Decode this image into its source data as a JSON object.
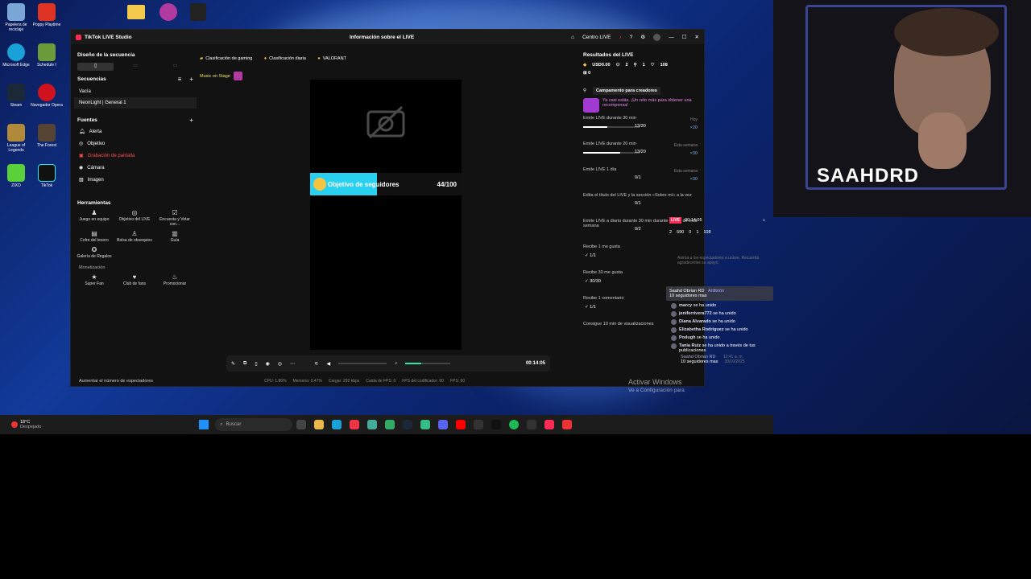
{
  "window": {
    "title": "TikTok LIVE Studio",
    "center_title": "Información sobre el LIVE",
    "centro_live": "Centro LIVE"
  },
  "left": {
    "scene_design": "Diseño de la secuencia",
    "sequences_title": "Secuencias",
    "sequences": [
      "Vacía",
      "NeonLight | General 1"
    ],
    "sources_title": "Fuentes",
    "sources": [
      {
        "label": "Alerta",
        "icon": "bell-icon"
      },
      {
        "label": "Objetivo",
        "icon": "target-icon"
      },
      {
        "label": "Grabación de pantalla",
        "icon": "screen-record-icon",
        "color": "#ff4d4d"
      },
      {
        "label": "Cámara",
        "icon": "camera-icon"
      },
      {
        "label": "Imagen",
        "icon": "image-icon"
      }
    ],
    "tools_title": "Herramientas",
    "tools": [
      "Juego en equipo",
      "Objetivo del LIVE",
      "Encuesta y Votar con...",
      "Cofre del tesoro",
      "Bolsa de obsequios",
      "Guía",
      "Galería de Regalos"
    ],
    "monetization_title": "Monetización",
    "monetization": [
      "Super Fan",
      "Club de fans",
      "Promocionar"
    ],
    "footer": "Aumentar el número de espectadores"
  },
  "center": {
    "chips": [
      "Clasificación de gaming",
      "Clasificación diaria",
      "VALORANT"
    ],
    "music": "Music on Stage",
    "goal_label": "Objetivo de seguidores",
    "goal_count": "44/100",
    "goal_fraction": 0.44,
    "timer": "00:14:05",
    "stats": [
      "CPU: 1.86%",
      "Memoria: 0.47%",
      "Cargar: 292 kbps",
      "Caída de FPS: 0",
      "FPS del codificador: 60",
      "FPS: 60"
    ]
  },
  "right": {
    "title": "Resultados del LIVE",
    "usd": "USD0.00",
    "stat_a": "2",
    "stat_b": "1",
    "likes": "108",
    "gifts": "0",
    "camp": "Campamento para creadores",
    "camp_desc": "Ya casi estás. ¡Un reto más para obtener una recompensa!",
    "tasks": [
      {
        "title": "Emite LIVE durante 30 min",
        "count": "13/30",
        "tag": "Hoy",
        "reward": "×20",
        "progress": 0.43
      },
      {
        "title": "Emite LIVE durante 20 min",
        "count": "13/20",
        "tag": "Esta semana",
        "reward": "×30",
        "progress": 0.65
      },
      {
        "title": "Emite LIVE 1 día",
        "count": "0/1",
        "tag": "Esta semana",
        "reward": "×30",
        "progress": 0
      },
      {
        "title": "Edita el título del LIVE y la sección «Sobre mí» a la vez",
        "count": "0/1",
        "tag": "",
        "reward": "",
        "progress": 0
      },
      {
        "title": "Emite LIVE a diario durante 30 min durante 2 días de esta semana",
        "count": "0/2",
        "tag": "",
        "reward": "",
        "progress": 0
      },
      {
        "title": "Recibe 1 me gusta",
        "count": "1/1",
        "tag": "",
        "reward": "",
        "progress": 1
      },
      {
        "title": "Recibe 30 me gusta",
        "count": "30/30",
        "tag": "",
        "reward": "",
        "progress": 1
      },
      {
        "title": "Recibe 1 comentario",
        "count": "1/1",
        "tag": "",
        "reward": "",
        "progress": 1
      },
      {
        "title": "Consigue 10 min de visualizaciones",
        "count": "",
        "tag": "",
        "reward": "",
        "progress": 0
      }
    ]
  },
  "overlay": {
    "live_badge": "LIVE",
    "time": "00:14:05",
    "stats": [
      "2",
      "590",
      "0",
      "1",
      "108"
    ],
    "hint": "Anima a los espectadores a unirse. Recuerda agradecerles su apoyo.",
    "top_user": "Saahd Obrian RD",
    "top_badge": "Anfitrión",
    "top_msg": "10 seguidores mas",
    "joins": [
      {
        "name": "marcy",
        "msg": "se ha unido"
      },
      {
        "name": "jeniferrivera772",
        "msg": "se ha unido"
      },
      {
        "name": "Diana Alvarado",
        "msg": "se ha unido"
      },
      {
        "name": "Elizabetha Rodriguez",
        "msg": "se ha unido"
      },
      {
        "name": "Podugh",
        "msg": "se ha unido"
      },
      {
        "name": "Tania Ruiz",
        "msg": "se ha unido a través de tus publicaciones"
      }
    ],
    "last_user": "Saahd Obrian RD",
    "last_msg": "10 seguidores mas",
    "last_time": "12:41 a. m.",
    "last_date": "30/10/2025"
  },
  "activate": {
    "line1": "Activar Windows",
    "line2": "Ve a Configuración para"
  },
  "webcam": {
    "name": "SAAHDRD"
  },
  "taskbar": {
    "weather": "18°C",
    "weather_desc": "Despejado",
    "search": "Buscar"
  },
  "desktop": [
    "Papelera de reciclaje",
    "Poppy Playtime",
    "Microsoft Edge",
    "Schedule I",
    "Steam",
    "Navegador Opera",
    "League of Legends",
    "The Forest",
    "ZIXO",
    "TikTok"
  ]
}
